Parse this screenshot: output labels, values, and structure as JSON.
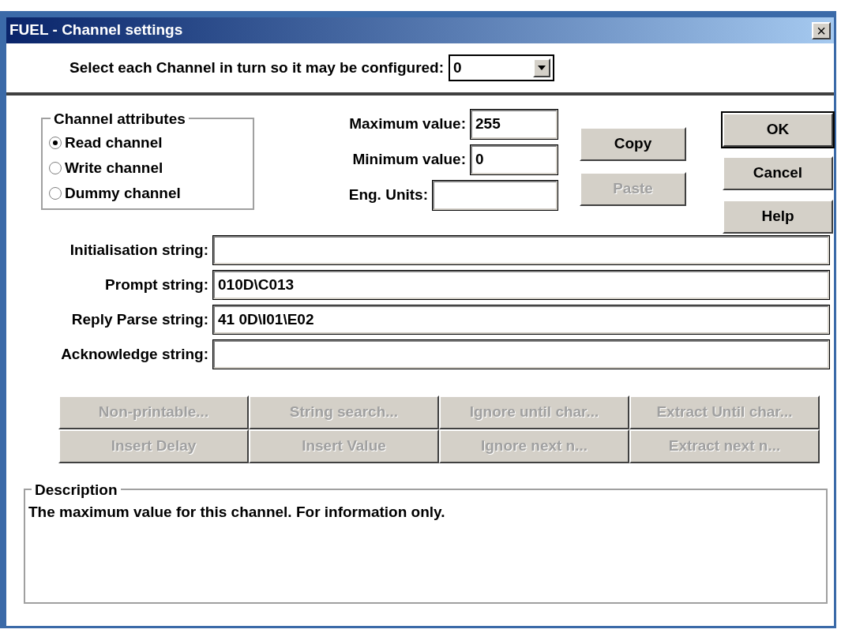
{
  "window": {
    "title": "FUEL - Channel settings",
    "close": "×"
  },
  "channel_select": {
    "label": "Select each Channel in turn so it may be configured:",
    "value": "0"
  },
  "channel_attributes": {
    "title": "Channel attributes",
    "options": [
      {
        "label": "Read channel",
        "selected": true
      },
      {
        "label": "Write channel",
        "selected": false
      },
      {
        "label": "Dummy channel",
        "selected": false
      }
    ]
  },
  "range_fields": [
    {
      "label": "Maximum value:",
      "value": "255"
    },
    {
      "label": "Minimum value:",
      "value": "0"
    },
    {
      "label": "Eng. Units:",
      "kind": "wide"
    }
  ],
  "clipboard_buttons": [
    {
      "label": "Copy",
      "disabled": false
    },
    {
      "label": "Paste",
      "disabled": true
    }
  ],
  "dialog_buttons": [
    {
      "label": "OK",
      "default": true
    },
    {
      "label": "Cancel",
      "default": false
    },
    {
      "label": "Help",
      "default": false
    }
  ],
  "strings": [
    {
      "label": "Initialisation string:"
    },
    {
      "label": "Prompt string:",
      "value": "010D\\C013"
    },
    {
      "label": "Reply Parse string:",
      "value": "41 0D\\I01\\E02"
    },
    {
      "label": "Acknowledge string:"
    }
  ],
  "insert_buttons": [
    {
      "label": "Non-printable...",
      "disabled": true
    },
    {
      "label": "String search...",
      "disabled": true
    },
    {
      "label": "Ignore until char...",
      "disabled": true
    },
    {
      "label": "Extract Until char...",
      "disabled": true
    },
    {
      "label": "Insert Delay",
      "disabled": true
    },
    {
      "label": "Insert Value",
      "disabled": true
    },
    {
      "label": "Ignore next n...",
      "disabled": true
    },
    {
      "label": "Extract next n...",
      "disabled": true
    }
  ],
  "description": {
    "title": "Description",
    "text": "The maximum value for this channel. For information only."
  }
}
